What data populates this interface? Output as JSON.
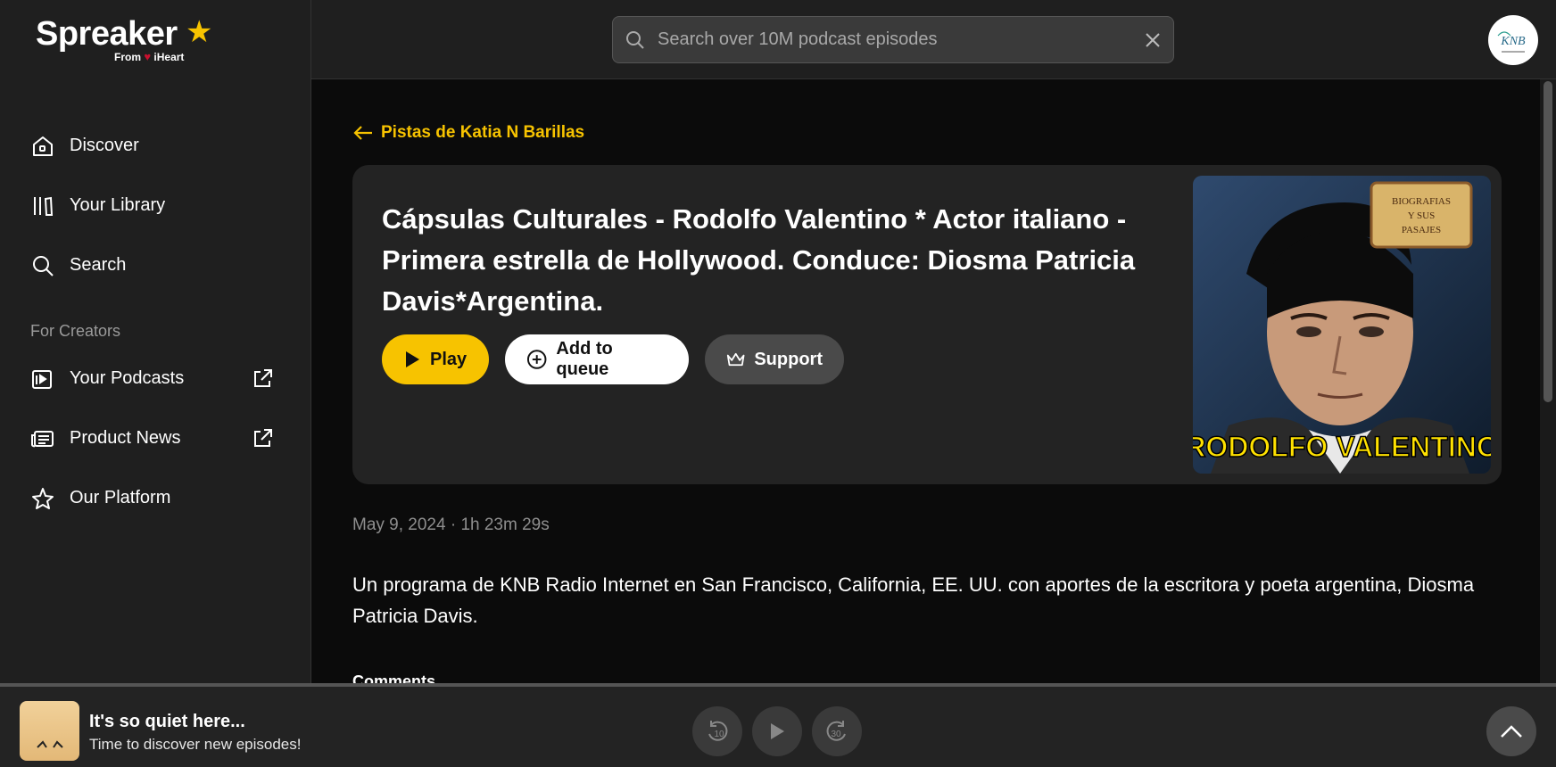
{
  "brand": {
    "name": "Spreaker",
    "from_label": "From",
    "partner": "iHeart"
  },
  "search": {
    "placeholder": "Search over 10M podcast episodes"
  },
  "sidebar": {
    "items": [
      {
        "label": "Discover",
        "icon": "home-icon"
      },
      {
        "label": "Your Library",
        "icon": "library-icon"
      },
      {
        "label": "Search",
        "icon": "search-icon"
      }
    ],
    "section_label": "For Creators",
    "creator_items": [
      {
        "label": "Your Podcasts",
        "icon": "podcast-icon",
        "external": true
      },
      {
        "label": "Product News",
        "icon": "news-icon",
        "external": true
      },
      {
        "label": "Our Platform",
        "icon": "star-icon",
        "external": false
      }
    ]
  },
  "episode": {
    "back_label": "Pistas de Katia N Barillas",
    "title": "Cápsulas Culturales - Rodolfo Valentino * Actor italiano - Primera estrella de Hollywood. Conduce: Diosma Patricia Davis*Argentina.",
    "buttons": {
      "play": "Play",
      "queue": "Add to queue",
      "support": "Support"
    },
    "cover_text": "RODOLFO VALENTINO",
    "cover_scroll_text": "BIOGRAFIAS Y SUS PASAJES",
    "meta": "May 9, 2024 · 1h 23m 29s",
    "description": "Un programa de KNB Radio Internet en San Francisco, California, EE. UU. con aportes de la escritora y poeta argentina, Diosma Patricia Davis.",
    "comments_label": "Comments"
  },
  "player": {
    "title": "It's so quiet here...",
    "subtitle": "Time to discover new episodes!",
    "rewind_label": "10",
    "forward_label": "30"
  },
  "colors": {
    "accent": "#f7c300",
    "background": "#0b0b0b",
    "panel": "#232323"
  }
}
